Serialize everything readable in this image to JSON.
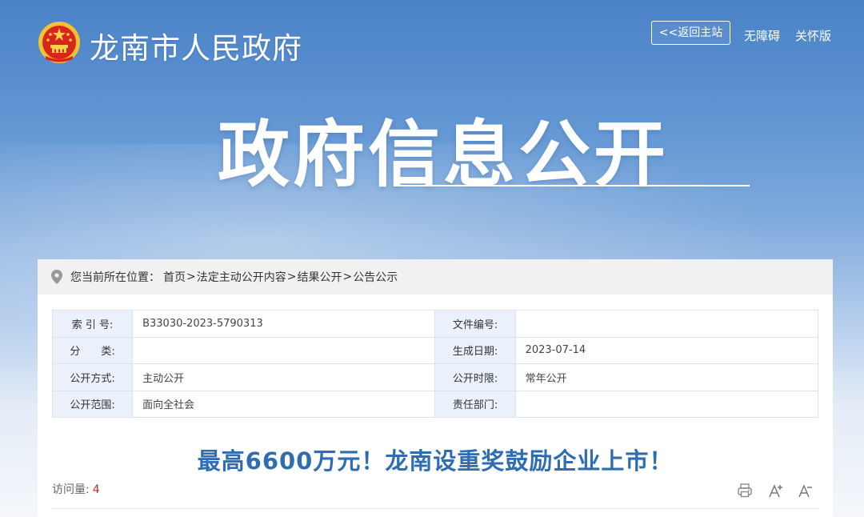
{
  "header": {
    "site_title": "龙南市人民政府",
    "back_home": "<<返回主站",
    "accessibility": "无障碍",
    "care_mode": "关怀版",
    "emblem_icon": "national-emblem-icon"
  },
  "hero": {
    "title": "政府信息公开"
  },
  "breadcrumb": {
    "label": "您当前所在位置：",
    "items": [
      "首页",
      "法定主动公开内容",
      "结果公开",
      "公告公示"
    ],
    "separator": ">"
  },
  "meta_table": {
    "rows": [
      {
        "k1": "索 引 号:",
        "v1": "B33030-2023-5790313",
        "k2": "文件编号:",
        "v2": ""
      },
      {
        "k1": "分　　类:",
        "v1": "",
        "k2": "生成日期:",
        "v2": "2023-07-14"
      },
      {
        "k1": "公开方式:",
        "v1": "主动公开",
        "k2": "公开时限:",
        "v2": "常年公开"
      },
      {
        "k1": "公开范围:",
        "v1": "面向全社会",
        "k2": "责任部门:",
        "v2": ""
      }
    ]
  },
  "article": {
    "title": "最高6600万元！龙南设重奖鼓励企业上市！",
    "visits_label": "访问量:",
    "visits_count": "4"
  },
  "tools": {
    "print_icon": "printer-icon",
    "increase_font_icon": "font-increase-icon",
    "decrease_font_icon": "font-decrease-icon"
  },
  "colors": {
    "accent_title": "#2f6db0",
    "visit_count": "#c02a2a",
    "table_key_bg": "#eaf1fa"
  }
}
